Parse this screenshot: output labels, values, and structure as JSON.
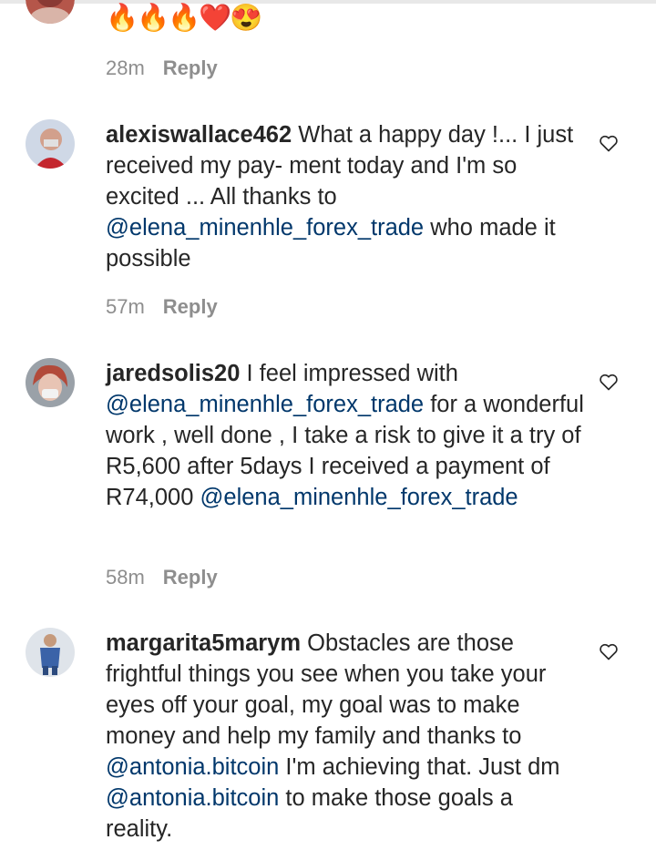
{
  "top_comment": {
    "emojis": "🔥🔥🔥❤️😍",
    "time": "28m",
    "reply_label": "Reply"
  },
  "comments": [
    {
      "username": "alexiswallace462",
      "segments": [
        {
          "text": " What a happy day !... I just received my pay- ment today and I'm so excited ... All thanks to ",
          "mention": false
        },
        {
          "text": "@elena_minenhle_forex_trade",
          "mention": true
        },
        {
          "text": " who made it possible",
          "mention": false
        }
      ],
      "time": "57m",
      "reply_label": "Reply"
    },
    {
      "username": "jaredsolis20",
      "segments": [
        {
          "text": " I feel impressed with ",
          "mention": false
        },
        {
          "text": "@elena_minenhle_forex_trade",
          "mention": true
        },
        {
          "text": " for a wonderful work , well done , I take a risk to give it a try of R5,600 after 5days I received a payment of R74,000 ",
          "mention": false
        },
        {
          "text": "@elena_minenhle_forex_trade",
          "mention": true
        }
      ],
      "time": "58m",
      "reply_label": "Reply"
    },
    {
      "username": "margarita5marym",
      "segments": [
        {
          "text": " Obstacles are those frightful things you see when you take your eyes off your goal, my goal was to make money and help my family and thanks to ",
          "mention": false
        },
        {
          "text": "@antonia.bitcoin",
          "mention": true
        },
        {
          "text": " I'm achieving that. Just dm ",
          "mention": false
        },
        {
          "text": "@antonia.bitcoin",
          "mention": true
        },
        {
          "text": " to make those goals a reality.",
          "mention": false
        }
      ],
      "time": "",
      "reply_label": ""
    }
  ],
  "colors": {
    "text": "#262626",
    "mention": "#00376b",
    "meta": "#8e8e8e"
  },
  "icons": {
    "like": "heart-outline-icon"
  }
}
